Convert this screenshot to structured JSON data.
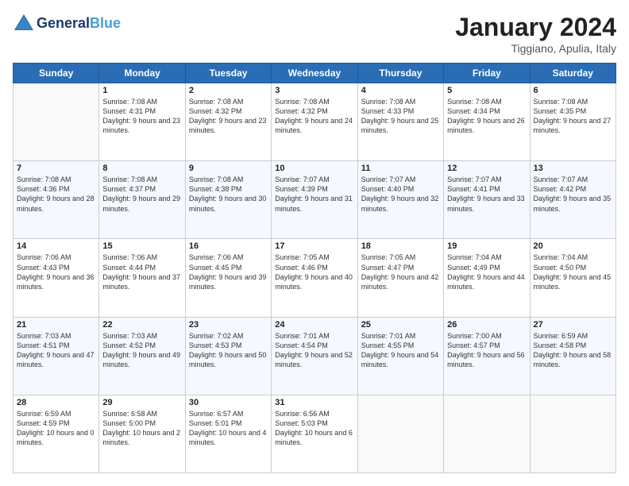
{
  "header": {
    "logo": {
      "line1": "General",
      "line2": "Blue"
    },
    "title": "January 2024",
    "location": "Tiggiano, Apulia, Italy"
  },
  "weekdays": [
    "Sunday",
    "Monday",
    "Tuesday",
    "Wednesday",
    "Thursday",
    "Friday",
    "Saturday"
  ],
  "weeks": [
    [
      {
        "day": "",
        "sunrise": "",
        "sunset": "",
        "daylight": ""
      },
      {
        "day": "1",
        "sunrise": "7:08 AM",
        "sunset": "4:31 PM",
        "daylight": "9 hours and 23 minutes."
      },
      {
        "day": "2",
        "sunrise": "7:08 AM",
        "sunset": "4:32 PM",
        "daylight": "9 hours and 23 minutes."
      },
      {
        "day": "3",
        "sunrise": "7:08 AM",
        "sunset": "4:32 PM",
        "daylight": "9 hours and 24 minutes."
      },
      {
        "day": "4",
        "sunrise": "7:08 AM",
        "sunset": "4:33 PM",
        "daylight": "9 hours and 25 minutes."
      },
      {
        "day": "5",
        "sunrise": "7:08 AM",
        "sunset": "4:34 PM",
        "daylight": "9 hours and 26 minutes."
      },
      {
        "day": "6",
        "sunrise": "7:08 AM",
        "sunset": "4:35 PM",
        "daylight": "9 hours and 27 minutes."
      }
    ],
    [
      {
        "day": "7",
        "sunrise": "7:08 AM",
        "sunset": "4:36 PM",
        "daylight": "9 hours and 28 minutes."
      },
      {
        "day": "8",
        "sunrise": "7:08 AM",
        "sunset": "4:37 PM",
        "daylight": "9 hours and 29 minutes."
      },
      {
        "day": "9",
        "sunrise": "7:08 AM",
        "sunset": "4:38 PM",
        "daylight": "9 hours and 30 minutes."
      },
      {
        "day": "10",
        "sunrise": "7:07 AM",
        "sunset": "4:39 PM",
        "daylight": "9 hours and 31 minutes."
      },
      {
        "day": "11",
        "sunrise": "7:07 AM",
        "sunset": "4:40 PM",
        "daylight": "9 hours and 32 minutes."
      },
      {
        "day": "12",
        "sunrise": "7:07 AM",
        "sunset": "4:41 PM",
        "daylight": "9 hours and 33 minutes."
      },
      {
        "day": "13",
        "sunrise": "7:07 AM",
        "sunset": "4:42 PM",
        "daylight": "9 hours and 35 minutes."
      }
    ],
    [
      {
        "day": "14",
        "sunrise": "7:06 AM",
        "sunset": "4:43 PM",
        "daylight": "9 hours and 36 minutes."
      },
      {
        "day": "15",
        "sunrise": "7:06 AM",
        "sunset": "4:44 PM",
        "daylight": "9 hours and 37 minutes."
      },
      {
        "day": "16",
        "sunrise": "7:06 AM",
        "sunset": "4:45 PM",
        "daylight": "9 hours and 39 minutes."
      },
      {
        "day": "17",
        "sunrise": "7:05 AM",
        "sunset": "4:46 PM",
        "daylight": "9 hours and 40 minutes."
      },
      {
        "day": "18",
        "sunrise": "7:05 AM",
        "sunset": "4:47 PM",
        "daylight": "9 hours and 42 minutes."
      },
      {
        "day": "19",
        "sunrise": "7:04 AM",
        "sunset": "4:49 PM",
        "daylight": "9 hours and 44 minutes."
      },
      {
        "day": "20",
        "sunrise": "7:04 AM",
        "sunset": "4:50 PM",
        "daylight": "9 hours and 45 minutes."
      }
    ],
    [
      {
        "day": "21",
        "sunrise": "7:03 AM",
        "sunset": "4:51 PM",
        "daylight": "9 hours and 47 minutes."
      },
      {
        "day": "22",
        "sunrise": "7:03 AM",
        "sunset": "4:52 PM",
        "daylight": "9 hours and 49 minutes."
      },
      {
        "day": "23",
        "sunrise": "7:02 AM",
        "sunset": "4:53 PM",
        "daylight": "9 hours and 50 minutes."
      },
      {
        "day": "24",
        "sunrise": "7:01 AM",
        "sunset": "4:54 PM",
        "daylight": "9 hours and 52 minutes."
      },
      {
        "day": "25",
        "sunrise": "7:01 AM",
        "sunset": "4:55 PM",
        "daylight": "9 hours and 54 minutes."
      },
      {
        "day": "26",
        "sunrise": "7:00 AM",
        "sunset": "4:57 PM",
        "daylight": "9 hours and 56 minutes."
      },
      {
        "day": "27",
        "sunrise": "6:59 AM",
        "sunset": "4:58 PM",
        "daylight": "9 hours and 58 minutes."
      }
    ],
    [
      {
        "day": "28",
        "sunrise": "6:59 AM",
        "sunset": "4:59 PM",
        "daylight": "10 hours and 0 minutes."
      },
      {
        "day": "29",
        "sunrise": "6:58 AM",
        "sunset": "5:00 PM",
        "daylight": "10 hours and 2 minutes."
      },
      {
        "day": "30",
        "sunrise": "6:57 AM",
        "sunset": "5:01 PM",
        "daylight": "10 hours and 4 minutes."
      },
      {
        "day": "31",
        "sunrise": "6:56 AM",
        "sunset": "5:03 PM",
        "daylight": "10 hours and 6 minutes."
      },
      {
        "day": "",
        "sunrise": "",
        "sunset": "",
        "daylight": ""
      },
      {
        "day": "",
        "sunrise": "",
        "sunset": "",
        "daylight": ""
      },
      {
        "day": "",
        "sunrise": "",
        "sunset": "",
        "daylight": ""
      }
    ]
  ]
}
